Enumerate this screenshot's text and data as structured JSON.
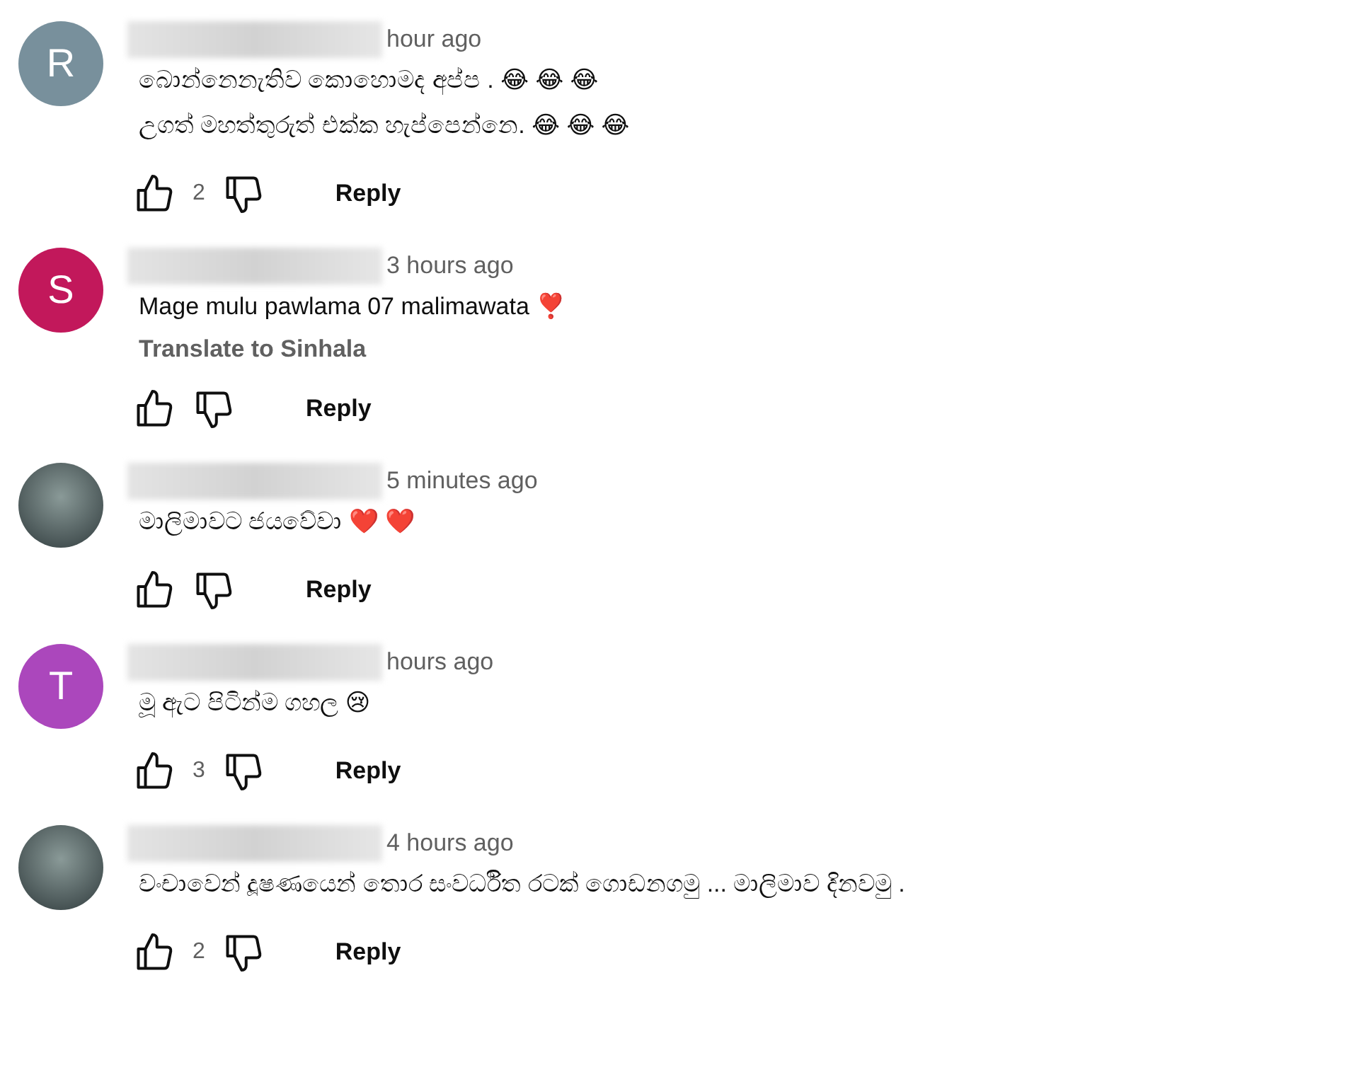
{
  "comments": [
    {
      "avatar": {
        "kind": "letter",
        "letter": "R",
        "color": "#78909c"
      },
      "time": "hour ago",
      "lines": [
        "බොන්නෙනැතිව කොහොමද  අප්ප . 😂 😂 😂",
        "උගත් මහත්තුරුත් එක්ක හැප්පෙන්නෙ. 😂 😂 😂"
      ],
      "likes": "2",
      "reply": "Reply"
    },
    {
      "avatar": {
        "kind": "letter",
        "letter": "S",
        "color": "#c2185b"
      },
      "time": "3 hours ago",
      "lines": [
        "Mage mulu pawlama 07 malimawata ❣️"
      ],
      "translate": "Translate to Sinhala",
      "reply": "Reply"
    },
    {
      "avatar": {
        "kind": "photo"
      },
      "time": "5 minutes ago",
      "lines": [
        "මාලිමාවට ජයවේවා ❤️ ❤️"
      ],
      "reply": "Reply"
    },
    {
      "avatar": {
        "kind": "letter",
        "letter": "T",
        "color": "#ab47bc"
      },
      "time": "hours ago",
      "lines": [
        "මූ ඇට පිටින්ම ගහල 😢"
      ],
      "likes": "3",
      "reply": "Reply"
    },
    {
      "avatar": {
        "kind": "photo"
      },
      "time": "4 hours ago",
      "lines": [
        "වංචාවෙන් දූෂණයෙන් තොර සංවර්ධිත රටක් ගොඩනගමු ... මාලිමාව දිනවමු ."
      ],
      "likes": "2",
      "reply": "Reply"
    }
  ]
}
